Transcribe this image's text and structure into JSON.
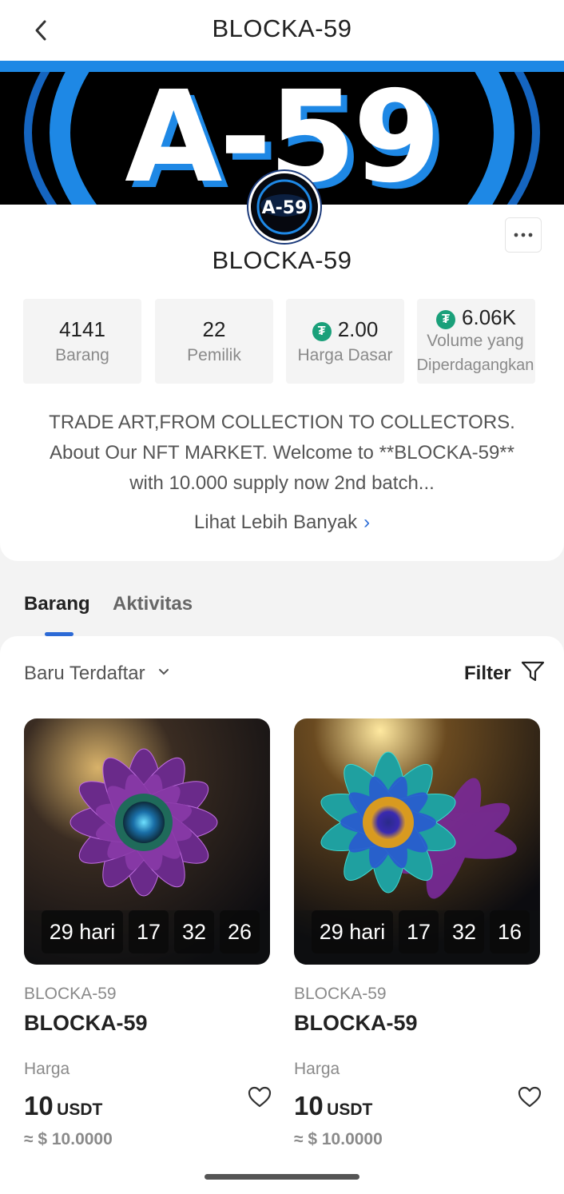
{
  "header": {
    "title": "BLOCKA-59",
    "back_icon": "chevron-left-icon"
  },
  "banner": {
    "text": "A-59",
    "colors": {
      "blue": "#1e88e5",
      "black": "#000000"
    }
  },
  "avatar": {
    "text": "A-59"
  },
  "collection": {
    "name": "BLOCKA-59",
    "more_icon": "more-horizontal-icon",
    "stats": [
      {
        "value": "4141",
        "label": "Barang"
      },
      {
        "value": "22",
        "label": "Pemilik"
      },
      {
        "value": "2.00",
        "label": "Harga Dasar",
        "icon": "tether-icon"
      },
      {
        "value": "6.06K",
        "label_line1": "Volume yang",
        "label_line2": "Diperdagangkan",
        "icon": "tether-icon"
      }
    ],
    "description": {
      "line1": "TRADE ART,FROM COLLECTION TO COLLECTORS.",
      "line2": "About Our NFT MARKET. Welcome to **BLOCKA-59**",
      "line3": "with 10.000 supply now 2nd batch..."
    },
    "see_more": "Lihat Lebih Banyak"
  },
  "tabs": [
    {
      "label": "Barang",
      "active": true
    },
    {
      "label": "Aktivitas",
      "active": false
    }
  ],
  "toolbar": {
    "sort_label": "Baru Terdaftar",
    "filter_label": "Filter"
  },
  "items": [
    {
      "collection": "BLOCKA-59",
      "name": "BLOCKA-59",
      "price_label": "Harga",
      "price": "10",
      "currency": "USDT",
      "usd": "≈ $ 10.0000",
      "timer": [
        "29 hari",
        "17",
        "32",
        "26"
      ]
    },
    {
      "collection": "BLOCKA-59",
      "name": "BLOCKA-59",
      "price_label": "Harga",
      "price": "10",
      "currency": "USDT",
      "usd": "≈ $ 10.0000",
      "timer": [
        "29 hari",
        "17",
        "32",
        "16"
      ]
    }
  ],
  "accent_color": "#2c6ad6",
  "tether_color": "#1aa07a"
}
